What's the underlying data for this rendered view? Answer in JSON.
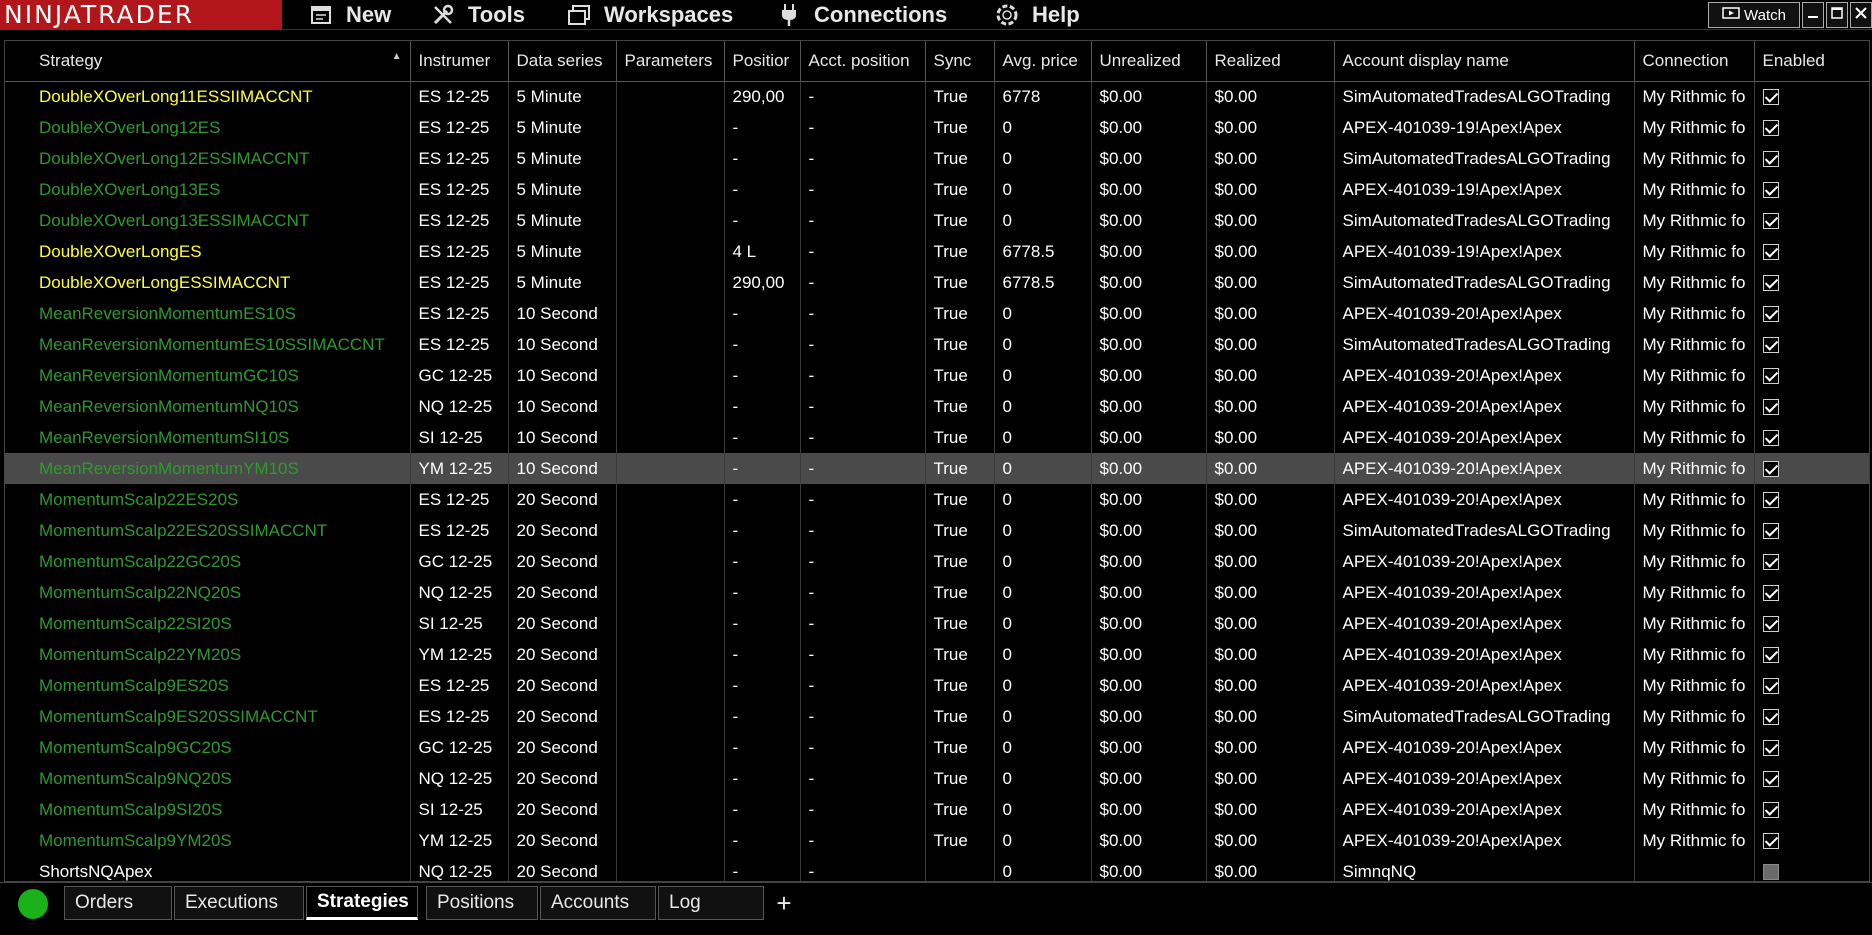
{
  "app": {
    "logo": "NINJATRADER"
  },
  "menu": {
    "new": "New",
    "tools": "Tools",
    "workspaces": "Workspaces",
    "connections": "Connections",
    "help": "Help",
    "watch": "Watch"
  },
  "columns": [
    "Strategy",
    "Instrumer",
    "Data series",
    "Parameters",
    "Positior",
    "Acct. position",
    "Sync",
    "Avg. price",
    "Unrealized",
    "Realized",
    "Account display name",
    "Connection",
    "Enabled"
  ],
  "rows": [
    {
      "strategy": "DoubleXOverLong11ESSIIMACCNT",
      "color": "yellow",
      "instrument": "ES 12-25",
      "series": "5 Minute",
      "parameters": "",
      "position": "290,00",
      "acct_position": "-",
      "sync": "True",
      "avg_price": "6778",
      "unrealized": "$0.00",
      "realized": "$0.00",
      "account": "SimAutomatedTradesALGOTrading",
      "connection": "My Rithmic fo",
      "enabled": "checked"
    },
    {
      "strategy": "DoubleXOverLong12ES",
      "color": "green",
      "instrument": "ES 12-25",
      "series": "5 Minute",
      "parameters": "",
      "position": "-",
      "acct_position": "-",
      "sync": "True",
      "avg_price": "0",
      "unrealized": "$0.00",
      "realized": "$0.00",
      "account": "APEX-401039-19!Apex!Apex",
      "connection": "My Rithmic fo",
      "enabled": "checked"
    },
    {
      "strategy": "DoubleXOverLong12ESSIMACCNT",
      "color": "green",
      "instrument": "ES 12-25",
      "series": "5 Minute",
      "parameters": "",
      "position": "-",
      "acct_position": "-",
      "sync": "True",
      "avg_price": "0",
      "unrealized": "$0.00",
      "realized": "$0.00",
      "account": "SimAutomatedTradesALGOTrading",
      "connection": "My Rithmic fo",
      "enabled": "checked"
    },
    {
      "strategy": "DoubleXOverLong13ES",
      "color": "green",
      "instrument": "ES 12-25",
      "series": "5 Minute",
      "parameters": "",
      "position": "-",
      "acct_position": "-",
      "sync": "True",
      "avg_price": "0",
      "unrealized": "$0.00",
      "realized": "$0.00",
      "account": "APEX-401039-19!Apex!Apex",
      "connection": "My Rithmic fo",
      "enabled": "checked"
    },
    {
      "strategy": "DoubleXOverLong13ESSIMACCNT",
      "color": "green",
      "instrument": "ES 12-25",
      "series": "5 Minute",
      "parameters": "",
      "position": "-",
      "acct_position": "-",
      "sync": "True",
      "avg_price": "0",
      "unrealized": "$0.00",
      "realized": "$0.00",
      "account": "SimAutomatedTradesALGOTrading",
      "connection": "My Rithmic fo",
      "enabled": "checked"
    },
    {
      "strategy": "DoubleXOverLongES",
      "color": "yellow",
      "instrument": "ES 12-25",
      "series": "5 Minute",
      "parameters": "",
      "position": "4 L",
      "acct_position": "-",
      "sync": "True",
      "avg_price": "6778.5",
      "unrealized": "$0.00",
      "realized": "$0.00",
      "account": "APEX-401039-19!Apex!Apex",
      "connection": "My Rithmic fo",
      "enabled": "checked"
    },
    {
      "strategy": "DoubleXOverLongESSIMACCNT",
      "color": "yellow",
      "instrument": "ES 12-25",
      "series": "5 Minute",
      "parameters": "",
      "position": "290,00",
      "acct_position": "-",
      "sync": "True",
      "avg_price": "6778.5",
      "unrealized": "$0.00",
      "realized": "$0.00",
      "account": "SimAutomatedTradesALGOTrading",
      "connection": "My Rithmic fo",
      "enabled": "checked"
    },
    {
      "strategy": "MeanReversionMomentumES10S",
      "color": "green",
      "instrument": "ES 12-25",
      "series": "10 Second",
      "parameters": "",
      "position": "-",
      "acct_position": "-",
      "sync": "True",
      "avg_price": "0",
      "unrealized": "$0.00",
      "realized": "$0.00",
      "account": "APEX-401039-20!Apex!Apex",
      "connection": "My Rithmic fo",
      "enabled": "checked"
    },
    {
      "strategy": "MeanReversionMomentumES10SSIMACCNT",
      "color": "green",
      "instrument": "ES 12-25",
      "series": "10 Second",
      "parameters": "",
      "position": "-",
      "acct_position": "-",
      "sync": "True",
      "avg_price": "0",
      "unrealized": "$0.00",
      "realized": "$0.00",
      "account": "SimAutomatedTradesALGOTrading",
      "connection": "My Rithmic fo",
      "enabled": "checked"
    },
    {
      "strategy": "MeanReversionMomentumGC10S",
      "color": "green",
      "instrument": "GC 12-25",
      "series": "10 Second",
      "parameters": "",
      "position": "-",
      "acct_position": "-",
      "sync": "True",
      "avg_price": "0",
      "unrealized": "$0.00",
      "realized": "$0.00",
      "account": "APEX-401039-20!Apex!Apex",
      "connection": "My Rithmic fo",
      "enabled": "checked"
    },
    {
      "strategy": "MeanReversionMomentumNQ10S",
      "color": "green",
      "instrument": "NQ 12-25",
      "series": "10 Second",
      "parameters": "",
      "position": "-",
      "acct_position": "-",
      "sync": "True",
      "avg_price": "0",
      "unrealized": "$0.00",
      "realized": "$0.00",
      "account": "APEX-401039-20!Apex!Apex",
      "connection": "My Rithmic fo",
      "enabled": "checked"
    },
    {
      "strategy": "MeanReversionMomentumSI10S",
      "color": "green",
      "instrument": "SI 12-25",
      "series": "10 Second",
      "parameters": "",
      "position": "-",
      "acct_position": "-",
      "sync": "True",
      "avg_price": "0",
      "unrealized": "$0.00",
      "realized": "$0.00",
      "account": "APEX-401039-20!Apex!Apex",
      "connection": "My Rithmic fo",
      "enabled": "checked"
    },
    {
      "strategy": "MeanReversionMomentumYM10S",
      "color": "green",
      "selected": true,
      "instrument": "YM 12-25",
      "series": "10 Second",
      "parameters": "",
      "position": "-",
      "acct_position": "-",
      "sync": "True",
      "avg_price": "0",
      "unrealized": "$0.00",
      "realized": "$0.00",
      "account": "APEX-401039-20!Apex!Apex",
      "connection": "My Rithmic fo",
      "enabled": "checked"
    },
    {
      "strategy": "MomentumScalp22ES20S",
      "color": "green",
      "instrument": "ES 12-25",
      "series": "20 Second",
      "parameters": "",
      "position": "-",
      "acct_position": "-",
      "sync": "True",
      "avg_price": "0",
      "unrealized": "$0.00",
      "realized": "$0.00",
      "account": "APEX-401039-20!Apex!Apex",
      "connection": "My Rithmic fo",
      "enabled": "checked"
    },
    {
      "strategy": "MomentumScalp22ES20SSIMACCNT",
      "color": "green",
      "instrument": "ES 12-25",
      "series": "20 Second",
      "parameters": "",
      "position": "-",
      "acct_position": "-",
      "sync": "True",
      "avg_price": "0",
      "unrealized": "$0.00",
      "realized": "$0.00",
      "account": "SimAutomatedTradesALGOTrading",
      "connection": "My Rithmic fo",
      "enabled": "checked"
    },
    {
      "strategy": "MomentumScalp22GC20S",
      "color": "green",
      "instrument": "GC 12-25",
      "series": "20 Second",
      "parameters": "",
      "position": "-",
      "acct_position": "-",
      "sync": "True",
      "avg_price": "0",
      "unrealized": "$0.00",
      "realized": "$0.00",
      "account": "APEX-401039-20!Apex!Apex",
      "connection": "My Rithmic fo",
      "enabled": "checked"
    },
    {
      "strategy": "MomentumScalp22NQ20S",
      "color": "green",
      "instrument": "NQ 12-25",
      "series": "20 Second",
      "parameters": "",
      "position": "-",
      "acct_position": "-",
      "sync": "True",
      "avg_price": "0",
      "unrealized": "$0.00",
      "realized": "$0.00",
      "account": "APEX-401039-20!Apex!Apex",
      "connection": "My Rithmic fo",
      "enabled": "checked"
    },
    {
      "strategy": "MomentumScalp22SI20S",
      "color": "green",
      "instrument": "SI 12-25",
      "series": "20 Second",
      "parameters": "",
      "position": "-",
      "acct_position": "-",
      "sync": "True",
      "avg_price": "0",
      "unrealized": "$0.00",
      "realized": "$0.00",
      "account": "APEX-401039-20!Apex!Apex",
      "connection": "My Rithmic fo",
      "enabled": "checked"
    },
    {
      "strategy": "MomentumScalp22YM20S",
      "color": "green",
      "instrument": "YM 12-25",
      "series": "20 Second",
      "parameters": "",
      "position": "-",
      "acct_position": "-",
      "sync": "True",
      "avg_price": "0",
      "unrealized": "$0.00",
      "realized": "$0.00",
      "account": "APEX-401039-20!Apex!Apex",
      "connection": "My Rithmic fo",
      "enabled": "checked"
    },
    {
      "strategy": "MomentumScalp9ES20S",
      "color": "green",
      "instrument": "ES 12-25",
      "series": "20 Second",
      "parameters": "",
      "position": "-",
      "acct_position": "-",
      "sync": "True",
      "avg_price": "0",
      "unrealized": "$0.00",
      "realized": "$0.00",
      "account": "APEX-401039-20!Apex!Apex",
      "connection": "My Rithmic fo",
      "enabled": "checked"
    },
    {
      "strategy": "MomentumScalp9ES20SSIMACCNT",
      "color": "green",
      "instrument": "ES 12-25",
      "series": "20 Second",
      "parameters": "",
      "position": "-",
      "acct_position": "-",
      "sync": "True",
      "avg_price": "0",
      "unrealized": "$0.00",
      "realized": "$0.00",
      "account": "SimAutomatedTradesALGOTrading",
      "connection": "My Rithmic fo",
      "enabled": "checked"
    },
    {
      "strategy": "MomentumScalp9GC20S",
      "color": "green",
      "instrument": "GC 12-25",
      "series": "20 Second",
      "parameters": "",
      "position": "-",
      "acct_position": "-",
      "sync": "True",
      "avg_price": "0",
      "unrealized": "$0.00",
      "realized": "$0.00",
      "account": "APEX-401039-20!Apex!Apex",
      "connection": "My Rithmic fo",
      "enabled": "checked"
    },
    {
      "strategy": "MomentumScalp9NQ20S",
      "color": "green",
      "instrument": "NQ 12-25",
      "series": "20 Second",
      "parameters": "",
      "position": "-",
      "acct_position": "-",
      "sync": "True",
      "avg_price": "0",
      "unrealized": "$0.00",
      "realized": "$0.00",
      "account": "APEX-401039-20!Apex!Apex",
      "connection": "My Rithmic fo",
      "enabled": "checked"
    },
    {
      "strategy": "MomentumScalp9SI20S",
      "color": "green",
      "instrument": "SI 12-25",
      "series": "20 Second",
      "parameters": "",
      "position": "-",
      "acct_position": "-",
      "sync": "True",
      "avg_price": "0",
      "unrealized": "$0.00",
      "realized": "$0.00",
      "account": "APEX-401039-20!Apex!Apex",
      "connection": "My Rithmic fo",
      "enabled": "checked"
    },
    {
      "strategy": "MomentumScalp9YM20S",
      "color": "green",
      "instrument": "YM 12-25",
      "series": "20 Second",
      "parameters": "",
      "position": "-",
      "acct_position": "-",
      "sync": "True",
      "avg_price": "0",
      "unrealized": "$0.00",
      "realized": "$0.00",
      "account": "APEX-401039-20!Apex!Apex",
      "connection": "My Rithmic fo",
      "enabled": "checked"
    },
    {
      "strategy": "ShortsNQApex",
      "color": "white",
      "instrument": "NQ 12-25",
      "series": "20 Second",
      "parameters": "",
      "position": "-",
      "acct_position": "-",
      "sync": "",
      "avg_price": "0",
      "unrealized": "$0.00",
      "realized": "$0.00",
      "account": "SimnqNQ",
      "connection": "",
      "enabled": "disabled"
    }
  ],
  "tabs": [
    "Orders",
    "Executions",
    "Strategies",
    "Positions",
    "Accounts",
    "Log"
  ],
  "active_tab": "Strategies",
  "add_tab_label": "+",
  "colors": {
    "logo_bg": "#b3161a",
    "active_strategy": "#ffff33",
    "idle_strategy": "#2e9a2e",
    "status_ok": "#19b219",
    "selected_row": "#4a4a4a"
  }
}
